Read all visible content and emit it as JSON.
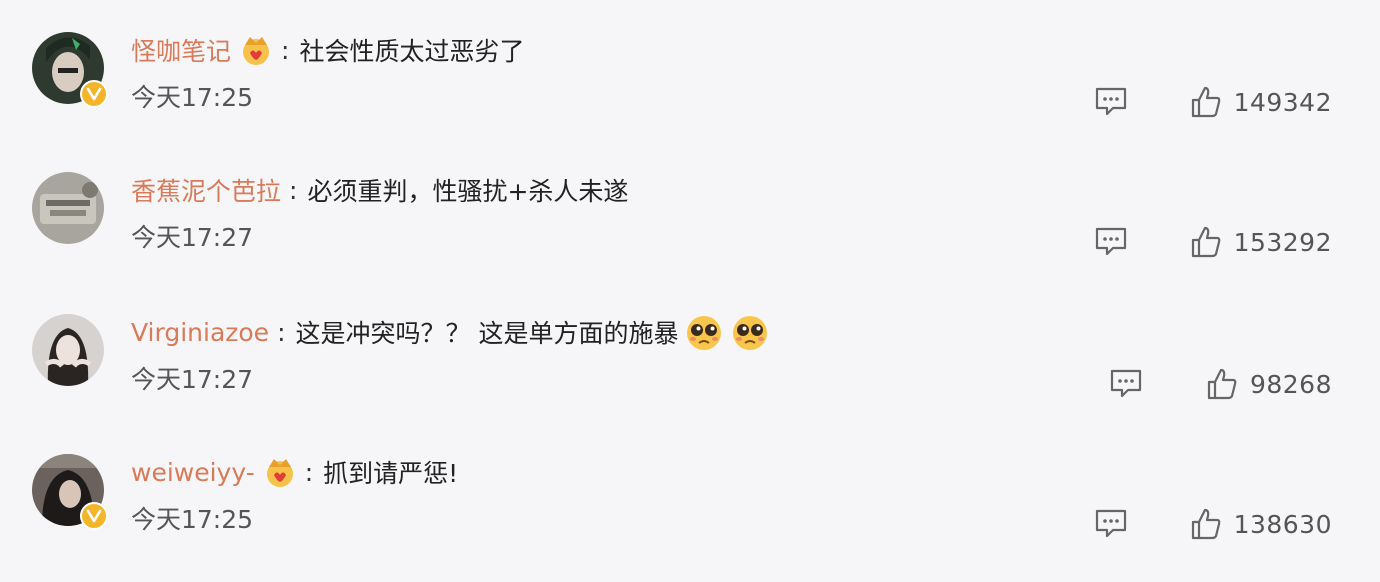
{
  "comments": [
    {
      "username": "怪咖笔记",
      "badge": "crown-badge-icon",
      "verified": true,
      "text": "社会性质太过恶劣了",
      "time": "今天17:25",
      "likes": "149342",
      "avatar_color": "#3a4a3a"
    },
    {
      "username": "香蕉泥个芭拉",
      "badge": "",
      "verified": false,
      "text": "必须重判，性骚扰+杀人未遂",
      "time": "今天17:27",
      "likes": "153292",
      "avatar_color": "#9a9890"
    },
    {
      "username": "Virginiazoe",
      "badge": "",
      "verified": false,
      "text": "这是冲突吗？？ 这是单方面的施暴",
      "emojis": [
        "crying-face-icon",
        "crying-face-icon"
      ],
      "time": "今天17:27",
      "likes": "98268",
      "avatar_color": "#c8c4c2"
    },
    {
      "username": "weiweiyy-",
      "badge": "crown-badge-icon",
      "verified": true,
      "text": "抓到请严惩!",
      "time": "今天17:25",
      "likes": "138630",
      "avatar_color": "#5a4e4a"
    }
  ],
  "colors": {
    "username": "#d97a5a",
    "verified_badge": "#f5b52a",
    "background": "#f6f6f8",
    "icon": "#666666"
  }
}
